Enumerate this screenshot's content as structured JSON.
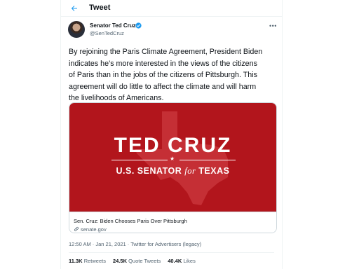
{
  "header": {
    "title": "Tweet"
  },
  "author": {
    "name": "Senator Ted Cruz",
    "handle": "@SenTedCruz"
  },
  "tweet": {
    "lines": [
      "By rejoining the Paris Climate Agreement, President Biden",
      "indicates he’s more interested in the views of the citizens",
      "of Paris than in the jobs of the citizens of Pittsburgh. This",
      "agreement will do little to affect the climate and will harm",
      "the livelihoods of Americans."
    ],
    "timestamp": "12:50 AM · Jan 21, 2021 · Twitter for Advertisers (legacy)"
  },
  "card": {
    "headline": "TED CRUZ",
    "sub_prefix": "U.S. SENATOR ",
    "sub_for": "for",
    "sub_suffix": " TEXAS",
    "title": "Sen. Cruz: Biden Chooses Paris Over Pittsburgh",
    "domain": "senate.gov",
    "image_bg": "#b2151c"
  },
  "stats": [
    {
      "count": "11.3K",
      "label": " Retweets"
    },
    {
      "count": "24.5K",
      "label": " Quote Tweets"
    },
    {
      "count": "40.4K",
      "label": " Likes"
    }
  ],
  "colors": {
    "accent": "#1d9bf0",
    "text": "#0f1419",
    "secondary": "#536471"
  },
  "icons": {
    "back": "arrow-left-icon",
    "verified": "verified-badge-icon",
    "more": "more-icon",
    "link": "link-icon"
  }
}
